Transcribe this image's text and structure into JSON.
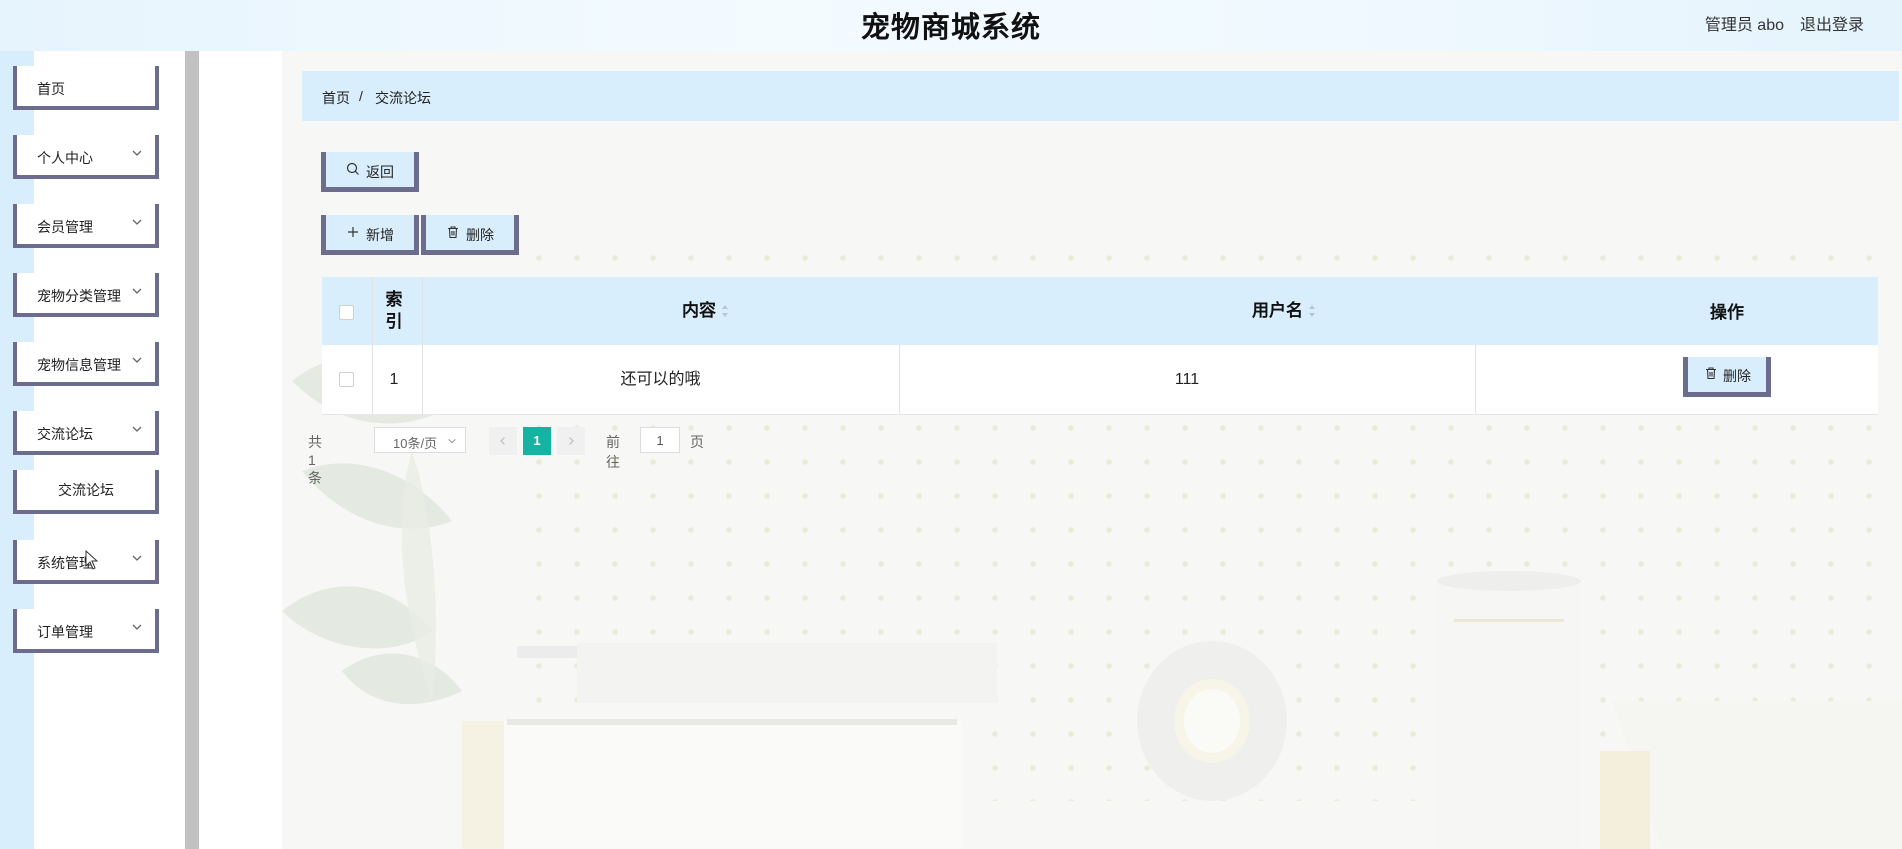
{
  "header": {
    "title": "宠物商城系统",
    "user": "管理员 abo",
    "logout": "退出登录"
  },
  "sidebar": {
    "items": [
      {
        "label": "首页"
      },
      {
        "label": "个人中心"
      },
      {
        "label": "会员管理"
      },
      {
        "label": "宠物分类管理"
      },
      {
        "label": "宠物信息管理"
      },
      {
        "label": "交流论坛"
      },
      {
        "label": "交流论坛"
      },
      {
        "label": "系统管理"
      },
      {
        "label": "订单管理"
      }
    ]
  },
  "breadcrumb": {
    "home": "首页",
    "sep": "/",
    "current": "交流论坛"
  },
  "toolbar": {
    "back": "返回",
    "add": "新增",
    "delete": "删除"
  },
  "table": {
    "columns": {
      "index": "索引",
      "content": "内容",
      "username": "用户名",
      "actions": "操作"
    },
    "rows": [
      {
        "index": "1",
        "content": "还可以的哦",
        "username": "111",
        "delete": "删除"
      }
    ]
  },
  "pagination": {
    "total": "共 1 条",
    "page_size": "10条/页",
    "current_page": "1",
    "goto_prefix": "前往",
    "goto_value": "1",
    "goto_suffix": "页"
  },
  "colors": {
    "accent": "#d9eefc",
    "border": "#6c6d8e",
    "active_page": "#13b5a2"
  }
}
